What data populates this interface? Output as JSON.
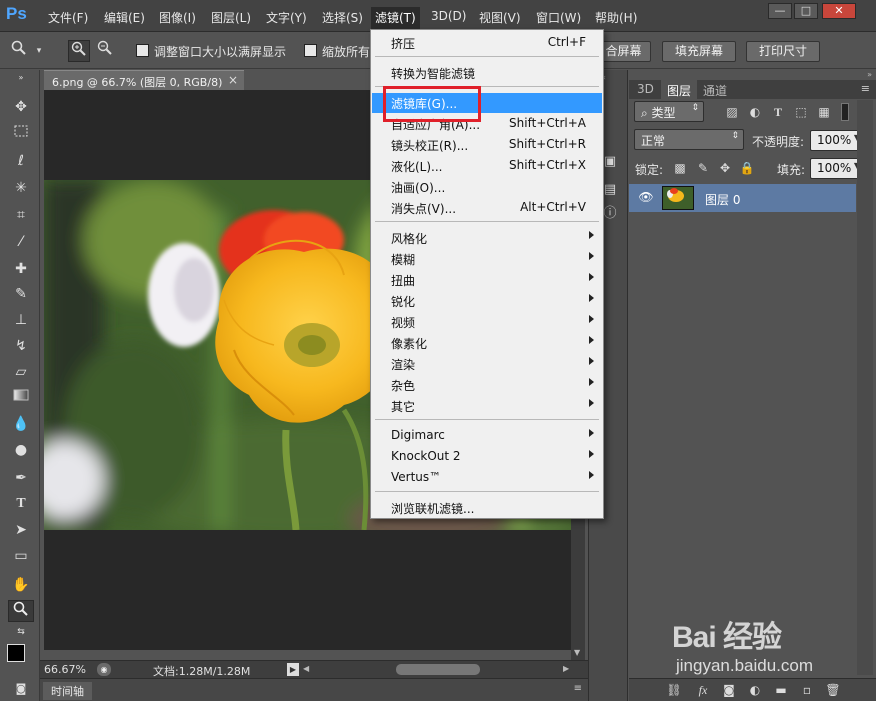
{
  "app": {
    "logo": "Ps"
  },
  "menubar": {
    "items": [
      "文件(F)",
      "编辑(E)",
      "图像(I)",
      "图层(L)",
      "文字(Y)",
      "选择(S)",
      "滤镜(T)",
      "3D(D)",
      "视图(V)",
      "窗口(W)",
      "帮助(H)"
    ],
    "active_index": 6
  },
  "window_controls": {
    "minimize": "—",
    "maximize": "□",
    "close": "✕"
  },
  "options": {
    "resize_windows_label": "调整窗口大小以满屏显示",
    "zoom_all_label": "缩放所有",
    "fit_screen_label": "合屏幕",
    "fill_screen_label": "填充屏幕",
    "print_size_label": "打印尺寸"
  },
  "document": {
    "tab_title": "6.png @ 66.7% (图层 0, RGB/8)",
    "tab_close": "×",
    "zoom": "66.67%",
    "doc_info": "文档:1.28M/1.28M"
  },
  "timeline": {
    "label": "时间轴"
  },
  "filter_menu": {
    "items": [
      {
        "label": "挤压",
        "shortcut": "Ctrl+F"
      },
      {
        "label": "转换为智能滤镜",
        "shortcut": ""
      },
      {
        "label": "滤镜库(G)...",
        "shortcut": "",
        "highlighted": true
      },
      {
        "label": "自适应广角(A)...",
        "shortcut": "Shift+Ctrl+A"
      },
      {
        "label": "镜头校正(R)...",
        "shortcut": "Shift+Ctrl+R"
      },
      {
        "label": "液化(L)...",
        "shortcut": "Shift+Ctrl+X"
      },
      {
        "label": "油画(O)...",
        "shortcut": ""
      },
      {
        "label": "消失点(V)...",
        "shortcut": "Alt+Ctrl+V"
      },
      {
        "label": "风格化",
        "submenu": true
      },
      {
        "label": "模糊",
        "submenu": true
      },
      {
        "label": "扭曲",
        "submenu": true
      },
      {
        "label": "锐化",
        "submenu": true
      },
      {
        "label": "视频",
        "submenu": true
      },
      {
        "label": "像素化",
        "submenu": true
      },
      {
        "label": "渲染",
        "submenu": true
      },
      {
        "label": "杂色",
        "submenu": true
      },
      {
        "label": "其它",
        "submenu": true
      },
      {
        "label": "Digimarc",
        "submenu": true
      },
      {
        "label": "KnockOut 2",
        "submenu": true
      },
      {
        "label": "Vertus™",
        "submenu": true
      },
      {
        "label": "浏览联机滤镜...",
        "shortcut": ""
      }
    ]
  },
  "layers_panel": {
    "tabs": [
      "3D",
      "图层",
      "通道"
    ],
    "active_tab": 1,
    "filter_kind": "类型",
    "blend_mode": "正常",
    "opacity_label": "不透明度:",
    "opacity_value": "100%",
    "lock_label": "锁定:",
    "fill_label": "填充:",
    "fill_value": "100%",
    "layer_name": "图层 0"
  },
  "watermark": {
    "brand": "Bai 经验",
    "site": "jingyan.baidu.com"
  },
  "colors": {
    "accent": "#3399ff",
    "highlight_box": "#e0202a",
    "ps_blue": "#4fa6ff"
  }
}
